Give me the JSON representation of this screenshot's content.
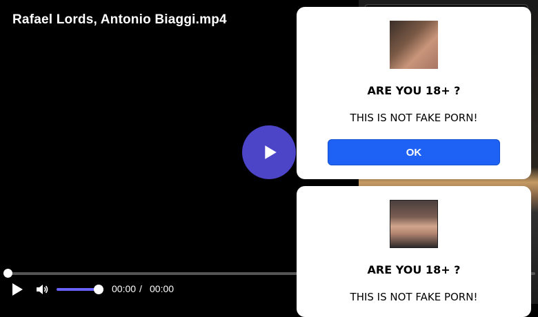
{
  "player": {
    "title": "Rafael Lords, Antonio Biaggi.mp4",
    "current_time": "00:00",
    "separator": "/",
    "duration": "00:00",
    "progress_fraction": 0,
    "volume_fraction": 1,
    "accent_color": "#4d45c8"
  },
  "popups": [
    {
      "question": "ARE YOU 18+ ?",
      "message": "THIS IS NOT FAKE PORN!",
      "button_label": "OK"
    },
    {
      "question": "ARE YOU 18+ ?",
      "message": "THIS IS NOT FAKE PORN!"
    }
  ],
  "colors": {
    "ok_button": "#1d62f5",
    "popup_bg": "#ffffff",
    "player_bg": "#000000"
  }
}
